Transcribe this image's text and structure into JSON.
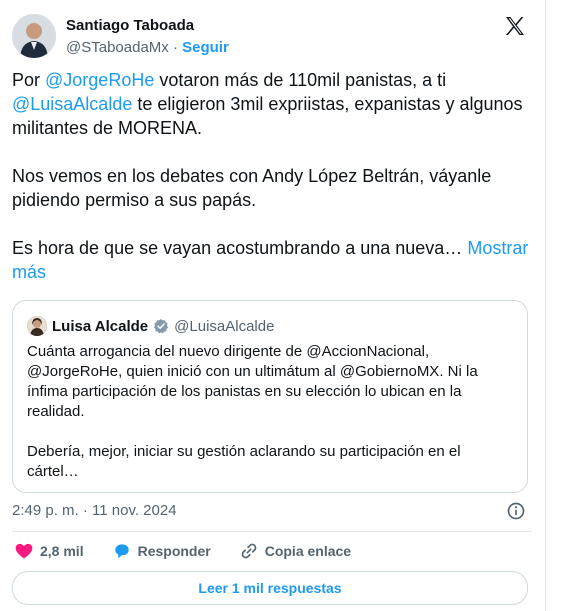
{
  "author": {
    "name": "Santiago Taboada",
    "handle": "@STaboadaMx",
    "separator": "·",
    "follow_label": "Seguir"
  },
  "tweet": {
    "p1_pre": "Por ",
    "p1_mention1": "@JorgeRoHe",
    "p1_mid": " votaron más de 110mil panistas, a ti ",
    "p1_mention2": "@LuisaAlcalde",
    "p1_post": " te eligieron 3mil expriistas, expanistas y algunos militantes de MORENA.",
    "p2": "Nos vemos en los debates con Andy López Beltrán, váyanle pidiendo permiso a sus papás.",
    "p3": "Es hora de que se vayan acostumbrando a una nueva…",
    "show_more": "Mostrar más"
  },
  "quote": {
    "name": "Luisa Alcalde",
    "handle": "@LuisaAlcalde",
    "p1": "Cuánta arrogancia del nuevo dirigente de @AccionNacional, @JorgeRoHe, quien inició con un ultimátum al @GobiernoMX. Ni la ínfima participación de los panistas en su elección lo ubican en la realidad.",
    "p2": "Debería, mejor, iniciar su gestión aclarando su participación en el cártel…"
  },
  "timestamp": "2:49 p. m. · 11 nov. 2024",
  "actions": {
    "likes": "2,8 mil",
    "reply_label": "Responder",
    "copy_label": "Copia enlace"
  },
  "replies_button": "Leer 1 mil respuestas",
  "colors": {
    "accent": "#1d9bf0",
    "like": "#f91880",
    "text": "#0f1419",
    "muted": "#536471",
    "border": "#cfd9de"
  },
  "icons": [
    "x-logo-icon",
    "verified-badge-icon",
    "info-icon",
    "heart-icon",
    "reply-bubble-icon",
    "link-icon"
  ]
}
